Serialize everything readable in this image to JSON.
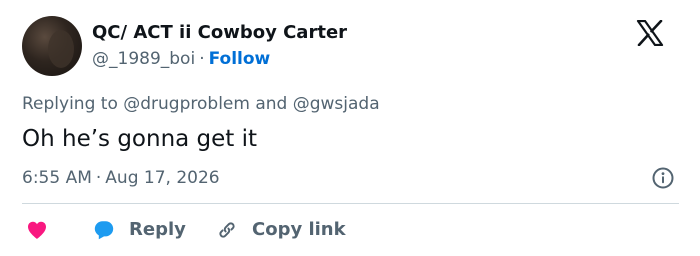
{
  "author": {
    "display_name": "QC/ ACT ii Cowboy Carter",
    "handle": "@_1989_boi",
    "separator": "·",
    "follow_label": "Follow"
  },
  "reply_context": {
    "text": "Replying to @drugproblem and @gwsjada"
  },
  "tweet": {
    "text": "Oh he’s gonna get it",
    "time": "6:55 AM",
    "separator": "·",
    "date": "Aug 17, 2026"
  },
  "actions": {
    "reply_label": "Reply",
    "copy_link_label": "Copy link"
  },
  "icons": {
    "logo": "x-logo-icon",
    "info": "info-icon",
    "like": "heart-icon",
    "reply": "speech-bubble-icon",
    "copy_link": "link-icon"
  },
  "colors": {
    "like": "#f91880",
    "reply": "#1d9bf0",
    "follow": "#006fd6",
    "muted": "#536471",
    "text": "#0f1419"
  }
}
